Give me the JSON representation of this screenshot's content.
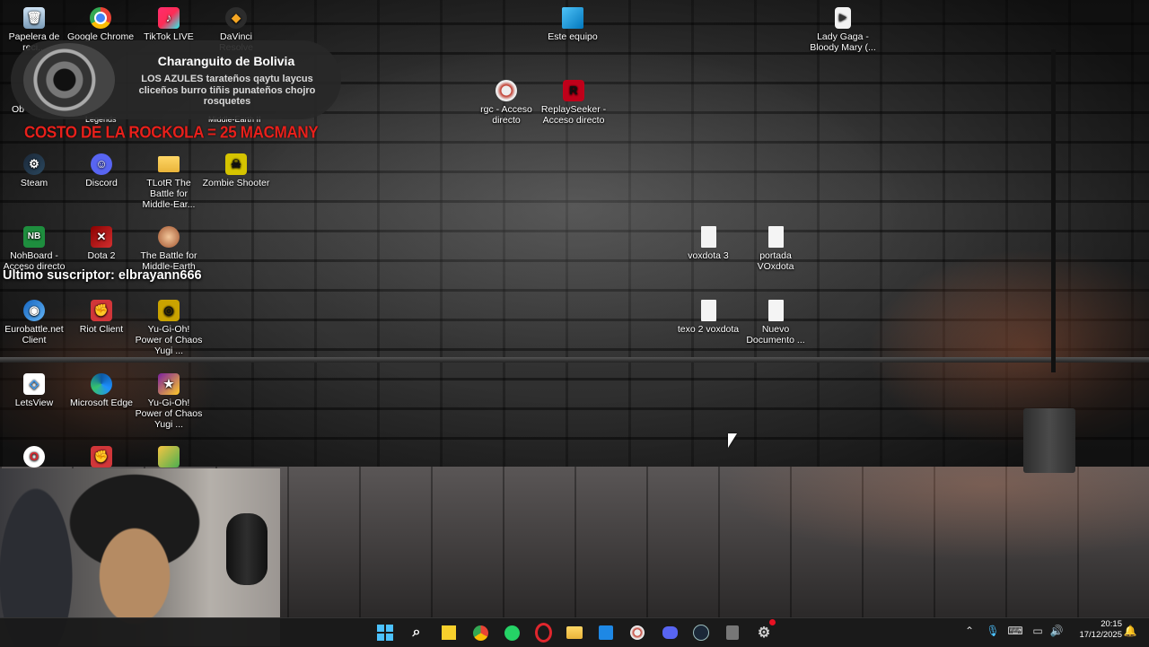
{
  "desktop": {
    "icons": [
      {
        "label": "Papelera de reci...",
        "icon": "recycle-bin-icon"
      },
      {
        "label": "Google Chrome",
        "icon": "chrome-icon"
      },
      {
        "label": "TikTok LIVE",
        "icon": "tiktok-icon"
      },
      {
        "label": "DaVinci Resolve",
        "icon": "davinci-icon"
      },
      {
        "label": "Este equipo",
        "icon": "computer-icon"
      },
      {
        "label": "Lady Gaga - Bloody Mary (...",
        "icon": "video-file-icon"
      },
      {
        "label": "rgc - Acceso directo",
        "icon": "rgc-icon"
      },
      {
        "label": "ReplaySeeker - Acceso directo",
        "icon": "replayseeker-icon"
      },
      {
        "label": "Steam",
        "icon": "steam-icon"
      },
      {
        "label": "Discord",
        "icon": "discord-icon"
      },
      {
        "label": "TLotR The Battle for Middle-Ear...",
        "icon": "folder-icon"
      },
      {
        "label": "Zombie Shooter",
        "icon": "zombie-icon"
      },
      {
        "label": "NohBoard - Acceso directo",
        "icon": "nohboard-icon"
      },
      {
        "label": "Dota 2",
        "icon": "dota-icon"
      },
      {
        "label": "The Battle for Middle-Earth",
        "icon": "bfme-icon"
      },
      {
        "label": "voxdota 3",
        "icon": "text-file-icon"
      },
      {
        "label": "portada VOxdota",
        "icon": "text-file-icon"
      },
      {
        "label": "Eurobattle.net Client",
        "icon": "eurobattle-icon"
      },
      {
        "label": "Riot Client",
        "icon": "riot-icon"
      },
      {
        "label": "Yu-Gi-Oh! Power of Chaos Yugi ...",
        "icon": "yugioh-icon"
      },
      {
        "label": "texo 2 voxdota",
        "icon": "text-file-icon"
      },
      {
        "label": "Nuevo Documento ...",
        "icon": "text-file-icon"
      },
      {
        "label": "LetsView",
        "icon": "letsview-icon"
      },
      {
        "label": "Microsoft Edge",
        "icon": "edge-icon"
      },
      {
        "label": "Yu-Gi-Oh! Power of Chaos Yugi ...",
        "icon": "yugioh-icon"
      },
      {
        "label": "Ob",
        "icon": "obs-icon"
      },
      {
        "label": "Legends",
        "icon": "legends-icon"
      },
      {
        "label": "Middle-Earth II",
        "icon": "bfme2-icon"
      }
    ]
  },
  "overlay": {
    "song_title": "Charanguito de Bolivia",
    "song_subtitle": "LOS AZULES tarateños qaytu laycus cliceños burro tiñis punateños chojro rosquetes",
    "rockola": "COSTO DE LA ROCKOLA = 25 MACMANY",
    "subscriber": "Ultimo suscriptor: elbrayann666"
  },
  "taskbar": {
    "apps": [
      "windows-start-icon",
      "search-icon",
      "sticky-notes-icon",
      "chrome-icon",
      "whatsapp-icon",
      "opera-icon",
      "file-explorer-icon",
      "store-icon",
      "rgc-icon",
      "discord-icon",
      "steam-icon",
      "app-icon",
      "settings-icon"
    ],
    "clock_time": "20:15",
    "clock_date": "17/12/2025"
  },
  "colors": {
    "rockola_red": "#e8201b",
    "taskbar_bg": "#1a1a1a"
  }
}
